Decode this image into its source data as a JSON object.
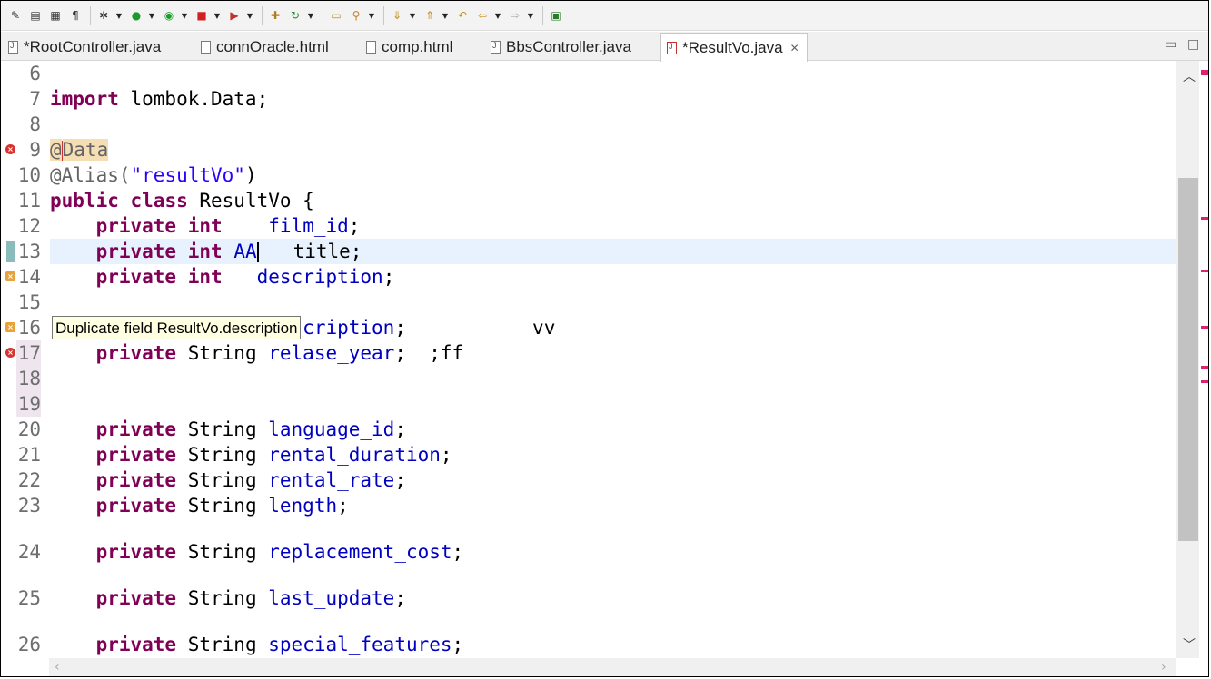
{
  "toolbar": {
    "icons": [
      "edit-icon",
      "save-all-icon",
      "save-icon",
      "show-whitespace-icon",
      "debug-icon",
      "run-icon",
      "external-tools-icon",
      "stop-icon",
      "skip-breakpoints-icon",
      "new-class-icon",
      "refresh-icon",
      "open-type-icon",
      "search-icon",
      "next-annotation-icon",
      "prev-annotation-icon",
      "back-icon",
      "forward-icon",
      "pin-editor-icon"
    ]
  },
  "tabs": [
    {
      "label": "*RootController.java"
    },
    {
      "label": "connOracle.html"
    },
    {
      "label": "comp.html"
    },
    {
      "label": "BbsController.java"
    },
    {
      "label": "*ResultVo.java",
      "active": true
    }
  ],
  "tooltip": {
    "text": "Duplicate field ResultVo.description"
  },
  "editor": {
    "lines": [
      {
        "n": "6",
        "tokens": []
      },
      {
        "n": "7",
        "tokens": [
          {
            "t": "import",
            "c": "kw"
          },
          {
            "t": " lombok.Data;",
            "c": ""
          }
        ]
      },
      {
        "n": "8",
        "tokens": []
      },
      {
        "n": "9",
        "tokens": [
          {
            "t": "@",
            "c": "ann hl-ann"
          },
          {
            "t": "|",
            "c": "cursor-red"
          },
          {
            "t": "Data",
            "c": "ann hl-ann"
          }
        ],
        "marker": "error"
      },
      {
        "n": "10",
        "tokens": [
          {
            "t": "@Alias(",
            "c": "ann"
          },
          {
            "t": "\"resultVo\"",
            "c": "str"
          },
          {
            "t": ")",
            "c": ""
          }
        ]
      },
      {
        "n": "11",
        "tokens": [
          {
            "t": "public",
            "c": "kw"
          },
          {
            "t": " ",
            "c": ""
          },
          {
            "t": "class",
            "c": "kw"
          },
          {
            "t": " ResultVo {",
            "c": ""
          }
        ]
      },
      {
        "n": "12",
        "tokens": [
          {
            "t": "    ",
            "c": ""
          },
          {
            "t": "private",
            "c": "kw"
          },
          {
            "t": " ",
            "c": ""
          },
          {
            "t": "int",
            "c": "kw"
          },
          {
            "t": "    ",
            "c": ""
          },
          {
            "t": "film_id",
            "c": "fld"
          },
          {
            "t": ";",
            "c": ""
          }
        ]
      },
      {
        "n": "13",
        "tokens": [
          {
            "t": "    ",
            "c": ""
          },
          {
            "t": "private",
            "c": "kw"
          },
          {
            "t": " ",
            "c": ""
          },
          {
            "t": "int",
            "c": "kw"
          },
          {
            "t": " ",
            "c": ""
          },
          {
            "t": "AA",
            "c": "fld"
          },
          {
            "t": "|",
            "c": "cursor"
          },
          {
            "t": "   title;",
            "c": ""
          }
        ],
        "current": true
      },
      {
        "n": "14",
        "tokens": [
          {
            "t": "    ",
            "c": ""
          },
          {
            "t": "private",
            "c": "kw"
          },
          {
            "t": " ",
            "c": ""
          },
          {
            "t": "int",
            "c": "kw"
          },
          {
            "t": "   ",
            "c": ""
          },
          {
            "t": "description",
            "c": "fld"
          },
          {
            "t": ";",
            "c": ""
          }
        ],
        "marker": "warn"
      },
      {
        "n": "15",
        "tokens": []
      },
      {
        "n": "16",
        "tokens": [
          {
            "t": "    ",
            "c": ""
          },
          {
            "t": "private",
            "c": "kw"
          },
          {
            "t": " String ",
            "c": ""
          },
          {
            "t": "description",
            "c": "fld"
          },
          {
            "t": ";           vv",
            "c": ""
          }
        ],
        "marker": "warn"
      },
      {
        "n": "17",
        "tokens": [
          {
            "t": "    ",
            "c": ""
          },
          {
            "t": "private",
            "c": "kw"
          },
          {
            "t": " String ",
            "c": ""
          },
          {
            "t": "relase_year",
            "c": "fld"
          },
          {
            "t": ";  ;ff",
            "c": ""
          }
        ],
        "marker": "error",
        "errline": true
      },
      {
        "n": "18",
        "tokens": [],
        "errline": true
      },
      {
        "n": "19",
        "tokens": [],
        "errline": true
      },
      {
        "n": "20",
        "tokens": [
          {
            "t": "    ",
            "c": ""
          },
          {
            "t": "private",
            "c": "kw"
          },
          {
            "t": " String ",
            "c": ""
          },
          {
            "t": "language_id",
            "c": "fld"
          },
          {
            "t": ";",
            "c": ""
          }
        ]
      },
      {
        "n": "21",
        "tokens": [
          {
            "t": "    ",
            "c": ""
          },
          {
            "t": "private",
            "c": "kw"
          },
          {
            "t": " String ",
            "c": ""
          },
          {
            "t": "rental_duration",
            "c": "fld"
          },
          {
            "t": ";",
            "c": ""
          }
        ]
      },
      {
        "n": "22",
        "tokens": [
          {
            "t": "    ",
            "c": ""
          },
          {
            "t": "private",
            "c": "kw"
          },
          {
            "t": " String ",
            "c": ""
          },
          {
            "t": "rental_rate",
            "c": "fld"
          },
          {
            "t": ";",
            "c": ""
          }
        ]
      },
      {
        "n": "23",
        "tokens": [
          {
            "t": "    ",
            "c": ""
          },
          {
            "t": "private",
            "c": "kw"
          },
          {
            "t": " String ",
            "c": ""
          },
          {
            "t": "length",
            "c": "fld"
          },
          {
            "t": ";",
            "c": ""
          }
        ]
      },
      {
        "n": "24",
        "tokens": [
          {
            "t": "    ",
            "c": ""
          },
          {
            "t": "private",
            "c": "kw"
          },
          {
            "t": " String ",
            "c": ""
          },
          {
            "t": "replacement_cost",
            "c": "fld"
          },
          {
            "t": ";",
            "c": ""
          }
        ]
      },
      {
        "n": "25",
        "tokens": [
          {
            "t": "    ",
            "c": ""
          },
          {
            "t": "private",
            "c": "kw"
          },
          {
            "t": " String ",
            "c": ""
          },
          {
            "t": "last_update",
            "c": "fld"
          },
          {
            "t": ";",
            "c": ""
          }
        ]
      },
      {
        "n": "26",
        "tokens": [
          {
            "t": "    ",
            "c": ""
          },
          {
            "t": "private",
            "c": "kw"
          },
          {
            "t": " String ",
            "c": ""
          },
          {
            "t": "special_features",
            "c": "fld"
          },
          {
            "t": ";",
            "c": ""
          }
        ]
      }
    ]
  }
}
